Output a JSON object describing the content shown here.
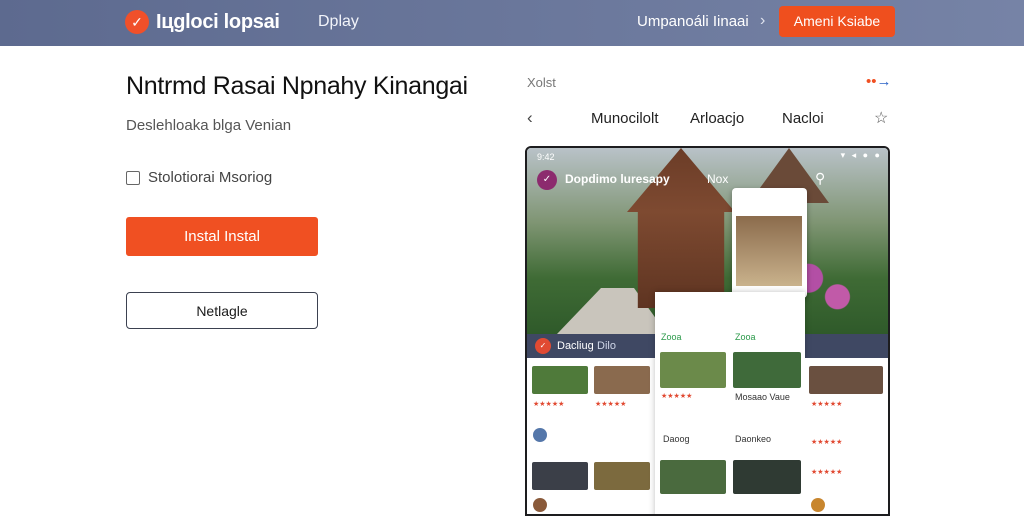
{
  "topbar": {
    "logo_icon": "check-icon",
    "brand": "Іцgloci lopsai",
    "nav_link": "Dplay",
    "right_link": "Umpanoáli Iinaai",
    "chevron": "›",
    "cta_label": "Ameni Ksiabe"
  },
  "hero": {
    "heading": "Nntrmd Rasai Npnahy Kinangai",
    "subtitle": "Deslehloaka blga Venian",
    "checkbox_label": "Stolotiorai Msoriog",
    "install_label": "Instal Instal",
    "secondary_label": "Netlagle"
  },
  "panel": {
    "label": "Xolst",
    "arrow_dots": "••",
    "arrow": "→",
    "back": "‹",
    "tabs": [
      "Munocilolt",
      "Arloacjo",
      "Nacloi"
    ],
    "bookmark": "☆"
  },
  "device": {
    "status_time": "9:42",
    "status_icons": "▾ ◂ ● ●",
    "app_badge": "✓",
    "app_title": "Dopdimo luresapy",
    "app_title_2": "Nox",
    "search": "⚲",
    "bar_icon": "✓",
    "bar_text": "Dacliug",
    "bar_text_2": "Dilo",
    "green_a": "Zooa",
    "green_b": "Zooa",
    "row_b1": "Daoog",
    "row_b2": "Daonkeo",
    "row_b3": "Mosaao Vaue",
    "stars": "★★★★★"
  }
}
